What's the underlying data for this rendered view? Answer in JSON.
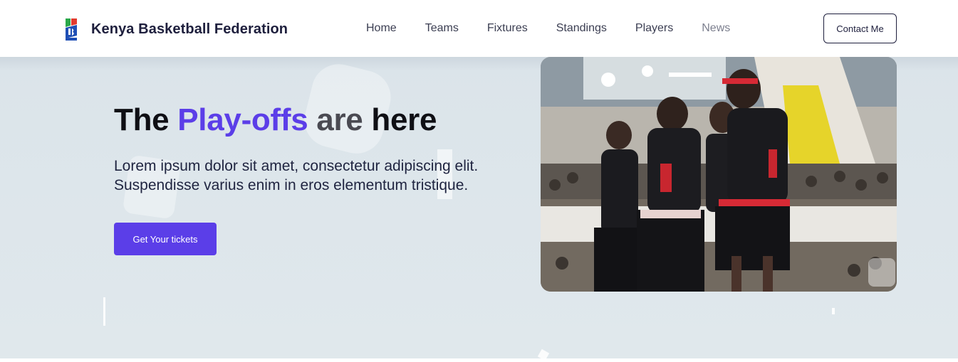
{
  "brand": {
    "name": "Kenya Basketball Federation",
    "logo_icon": "kbf-logo-icon"
  },
  "nav": {
    "items": [
      {
        "label": "Home"
      },
      {
        "label": "Teams"
      },
      {
        "label": "Fixtures"
      },
      {
        "label": "Standings"
      },
      {
        "label": "Players"
      },
      {
        "label": "News"
      }
    ],
    "contact_label": "Contact Me"
  },
  "hero": {
    "title_part1": "The ",
    "title_accent": "Play-offs",
    "title_part2": " are",
    "title_part3": " here",
    "description": "Lorem ipsum dolor sit amet, consectetur adipiscing elit. Suspendisse varius enim in eros elementum tristique.",
    "cta_label": "Get Your tickets",
    "image_subject": "basketball-team-huddle-photo"
  },
  "colors": {
    "accent": "#5b3ee8",
    "hero_bg": "#dbe4ea",
    "text_dark": "#1e1f3d"
  }
}
